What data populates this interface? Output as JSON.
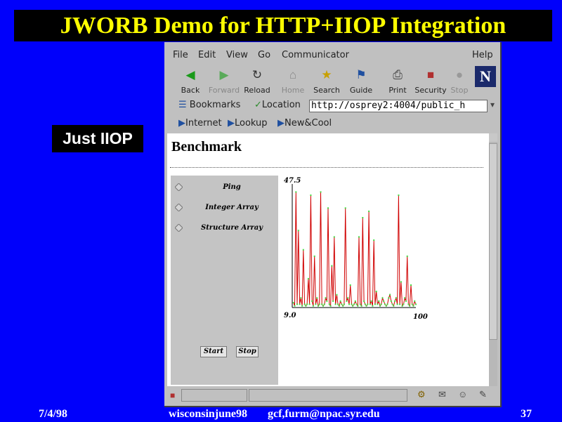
{
  "slide": {
    "title": "JWORB Demo for HTTP+IIOP Integration",
    "label": "Just IIOP",
    "footer": {
      "date": "7/4/98",
      "file": "wisconsinjune98",
      "email": "gcf,furm@npac.syr.edu",
      "page": "37"
    }
  },
  "browser": {
    "menu": [
      "File",
      "Edit",
      "View",
      "Go",
      "Communicator",
      "Help"
    ],
    "toolbar": [
      {
        "label": "Back",
        "icon": "back-arrow-icon",
        "enabled": true
      },
      {
        "label": "Forward",
        "icon": "forward-arrow-icon",
        "enabled": false
      },
      {
        "label": "Reload",
        "icon": "reload-icon",
        "enabled": true
      },
      {
        "label": "Home",
        "icon": "home-icon",
        "enabled": false
      },
      {
        "label": "Search",
        "icon": "search-icon",
        "enabled": true
      },
      {
        "label": "Guide",
        "icon": "guide-icon",
        "enabled": true
      },
      {
        "label": "Print",
        "icon": "print-icon",
        "enabled": true
      },
      {
        "label": "Security",
        "icon": "lock-icon",
        "enabled": true
      },
      {
        "label": "Stop",
        "icon": "stop-icon",
        "enabled": false
      }
    ],
    "logo_letter": "N",
    "bookmarks_label": "Bookmarks",
    "location_label": "Location",
    "url": "http://osprey2:4004/public_h",
    "personal": [
      "Internet",
      "Lookup",
      "New&Cool"
    ]
  },
  "page": {
    "heading": "Benchmark",
    "options": [
      "Ping",
      "Integer Array",
      "Structure Array"
    ],
    "start_label": "Start",
    "stop_label": "Stop"
  },
  "chart_data": {
    "type": "line",
    "title": "",
    "xlabel": "",
    "ylabel": "",
    "ymax_label": "47.5",
    "ymin_label": "9.0",
    "xmax_label": "100",
    "xlim": [
      0,
      100
    ],
    "ylim": [
      9.0,
      47.5
    ],
    "line_color": "#d00000",
    "marker_color": "#44dd44",
    "x": [
      1,
      2,
      3,
      4,
      5,
      6,
      7,
      8,
      9,
      10,
      11,
      12,
      13,
      14,
      15,
      16,
      17,
      18,
      19,
      20,
      21,
      22,
      23,
      24,
      25,
      26,
      27,
      28,
      29,
      30,
      31,
      32,
      33,
      34,
      35,
      36,
      37,
      38,
      39,
      40,
      41,
      42,
      43,
      44,
      45,
      46,
      47,
      48,
      49,
      50,
      51,
      52,
      53,
      54,
      55,
      56,
      57,
      58,
      59,
      60,
      61,
      62,
      63,
      64,
      65,
      66,
      67,
      68,
      69,
      70,
      71,
      72,
      73,
      74,
      75,
      76,
      77,
      78,
      79,
      80,
      81,
      82,
      83,
      84,
      85,
      86,
      87,
      88,
      89,
      90,
      91,
      92,
      93,
      94,
      95,
      96,
      97,
      98,
      99,
      100
    ],
    "y": [
      10.5,
      9.5,
      45,
      10,
      33,
      10,
      12,
      9.5,
      27,
      10,
      9.5,
      10,
      18,
      10,
      44,
      11,
      9.5,
      25,
      10,
      12,
      9.5,
      10,
      45,
      10,
      9.5,
      10,
      12,
      11,
      40,
      10,
      9.5,
      22,
      11,
      31,
      10,
      13,
      10,
      9.5,
      11,
      10,
      9.5,
      10,
      40,
      11,
      12,
      10,
      16,
      10,
      9.5,
      10,
      11,
      10,
      9.5,
      31,
      10,
      9.5,
      37,
      11,
      10,
      9.5,
      10,
      39,
      10,
      11,
      9.5,
      30,
      10,
      14,
      10,
      11,
      9.5,
      10,
      12,
      11,
      10,
      9.5,
      10,
      12,
      13,
      11,
      10,
      9.5,
      11,
      12,
      10,
      44,
      10,
      17,
      9.5,
      10,
      12,
      11,
      25,
      10,
      9.5,
      16,
      10,
      9.5,
      11,
      10
    ]
  }
}
